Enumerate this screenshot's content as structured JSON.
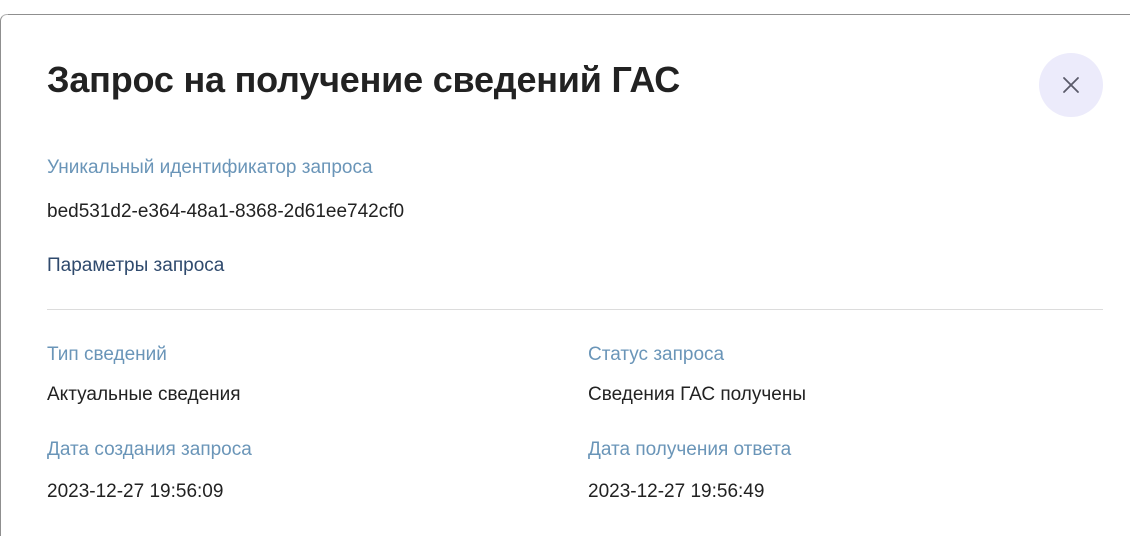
{
  "dialog": {
    "title": "Запрос на получение сведений ГАС",
    "close_icon": "close-icon"
  },
  "request_id": {
    "label": "Уникальный идентификатор запроса",
    "value": "bed531d2-e364-48a1-8368-2d61ee742cf0"
  },
  "params": {
    "section_title": "Параметры запроса",
    "info_type": {
      "label": "Тип сведений",
      "value": "Актуальные сведения"
    },
    "status": {
      "label": "Статус запроса",
      "value": "Сведения ГАС получены"
    },
    "created_date": {
      "label": "Дата создания запроса",
      "value": "2023-12-27 19:56:09"
    },
    "response_date": {
      "label": "Дата получения ответа",
      "value": "2023-12-27 19:56:49"
    }
  },
  "colors": {
    "label": "#6a95b8",
    "value": "#222222",
    "close_button_bg": "#ecebfb"
  }
}
